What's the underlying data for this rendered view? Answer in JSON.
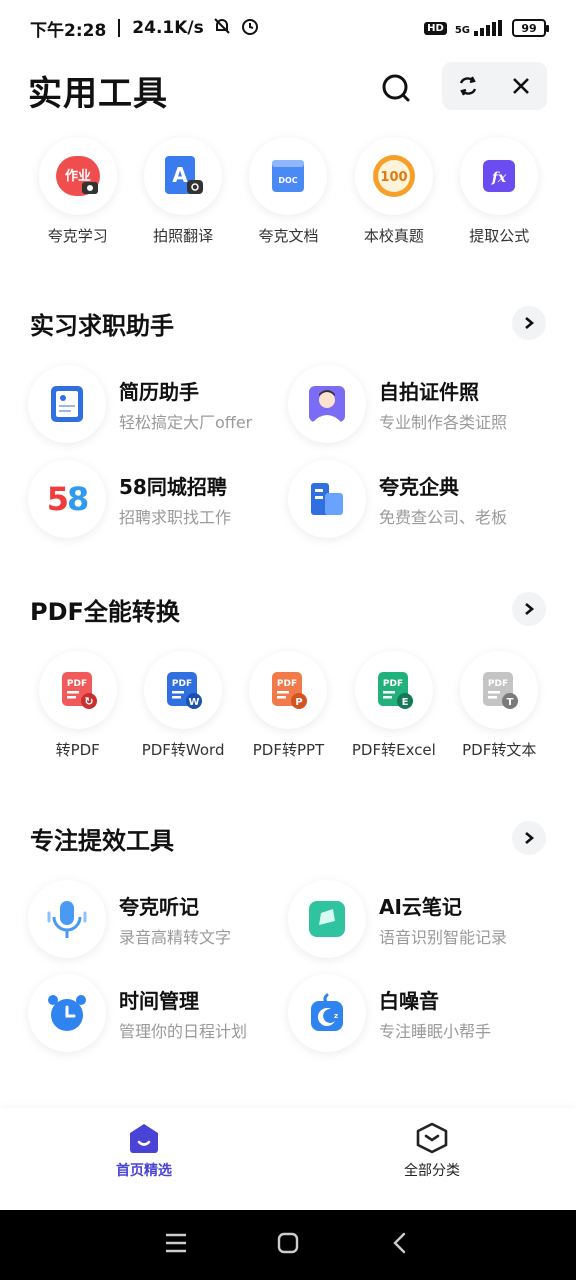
{
  "status_bar": {
    "time": "下午2:28",
    "net_speed": "24.1K/s",
    "hd": "HD",
    "signal": "5G",
    "battery": "99"
  },
  "header": {
    "title": "实用工具",
    "icons": {
      "search": "search-icon",
      "refresh": "refresh-icon",
      "close": "close-icon"
    }
  },
  "top_tools": [
    {
      "label": "夸克学习",
      "icon": "homework-camera-icon",
      "color": "#f04e4e",
      "glyph": "作业"
    },
    {
      "label": "拍照翻译",
      "icon": "photo-translate-icon",
      "color": "#3a7bf0",
      "glyph": "A"
    },
    {
      "label": "夸克文档",
      "icon": "document-icon",
      "color": "#4a8af5",
      "glyph": "DOC"
    },
    {
      "label": "本校真题",
      "icon": "exam-100-icon",
      "color": "#f6a02a",
      "glyph": "100"
    },
    {
      "label": "提取公式",
      "icon": "formula-icon",
      "color": "#6a4cf0",
      "glyph": "fx"
    }
  ],
  "sections": {
    "job": {
      "title": "实习求职助手",
      "items": [
        {
          "title": "简历助手",
          "subtitle": "轻松搞定大厂offer",
          "icon": "resume-icon"
        },
        {
          "title": "自拍证件照",
          "subtitle": "专业制作各类证照",
          "icon": "id-photo-icon"
        },
        {
          "title": "58同城招聘",
          "subtitle": "招聘求职找工作",
          "icon": "58-logo-icon",
          "glyph": "58"
        },
        {
          "title": "夸克企典",
          "subtitle": "免费查公司、老板",
          "icon": "company-icon"
        }
      ]
    },
    "pdf": {
      "title": "PDF全能转换",
      "items": [
        {
          "label": "转PDF",
          "icon": "to-pdf-icon",
          "color": "#f05a5a",
          "badge": "↻"
        },
        {
          "label": "PDF转Word",
          "icon": "pdf-to-word-icon",
          "color": "#2f6fe0",
          "badge": "W"
        },
        {
          "label": "PDF转PPT",
          "icon": "pdf-to-ppt-icon",
          "color": "#f07a4a",
          "badge": "P"
        },
        {
          "label": "PDF转Excel",
          "icon": "pdf-to-excel-icon",
          "color": "#22b07d",
          "badge": "E"
        },
        {
          "label": "PDF转文本",
          "icon": "pdf-to-text-icon",
          "color": "#b9b9b9",
          "badge": "T"
        }
      ],
      "pdf_glyph": "PDF"
    },
    "focus": {
      "title": "专注提效工具",
      "items": [
        {
          "title": "夸克听记",
          "subtitle": "录音高精转文字",
          "icon": "microphone-icon"
        },
        {
          "title": "AI云笔记",
          "subtitle": "语音识别智能记录",
          "icon": "note-icon"
        },
        {
          "title": "时间管理",
          "subtitle": "管理你的日程计划",
          "icon": "alarm-clock-icon"
        },
        {
          "title": "白噪音",
          "subtitle": "专注睡眠小帮手",
          "icon": "sleep-moon-icon"
        }
      ]
    }
  },
  "bottom_nav": {
    "home": "首页精选",
    "all": "全部分类"
  },
  "colors": {
    "accent": "#4a44d6"
  }
}
